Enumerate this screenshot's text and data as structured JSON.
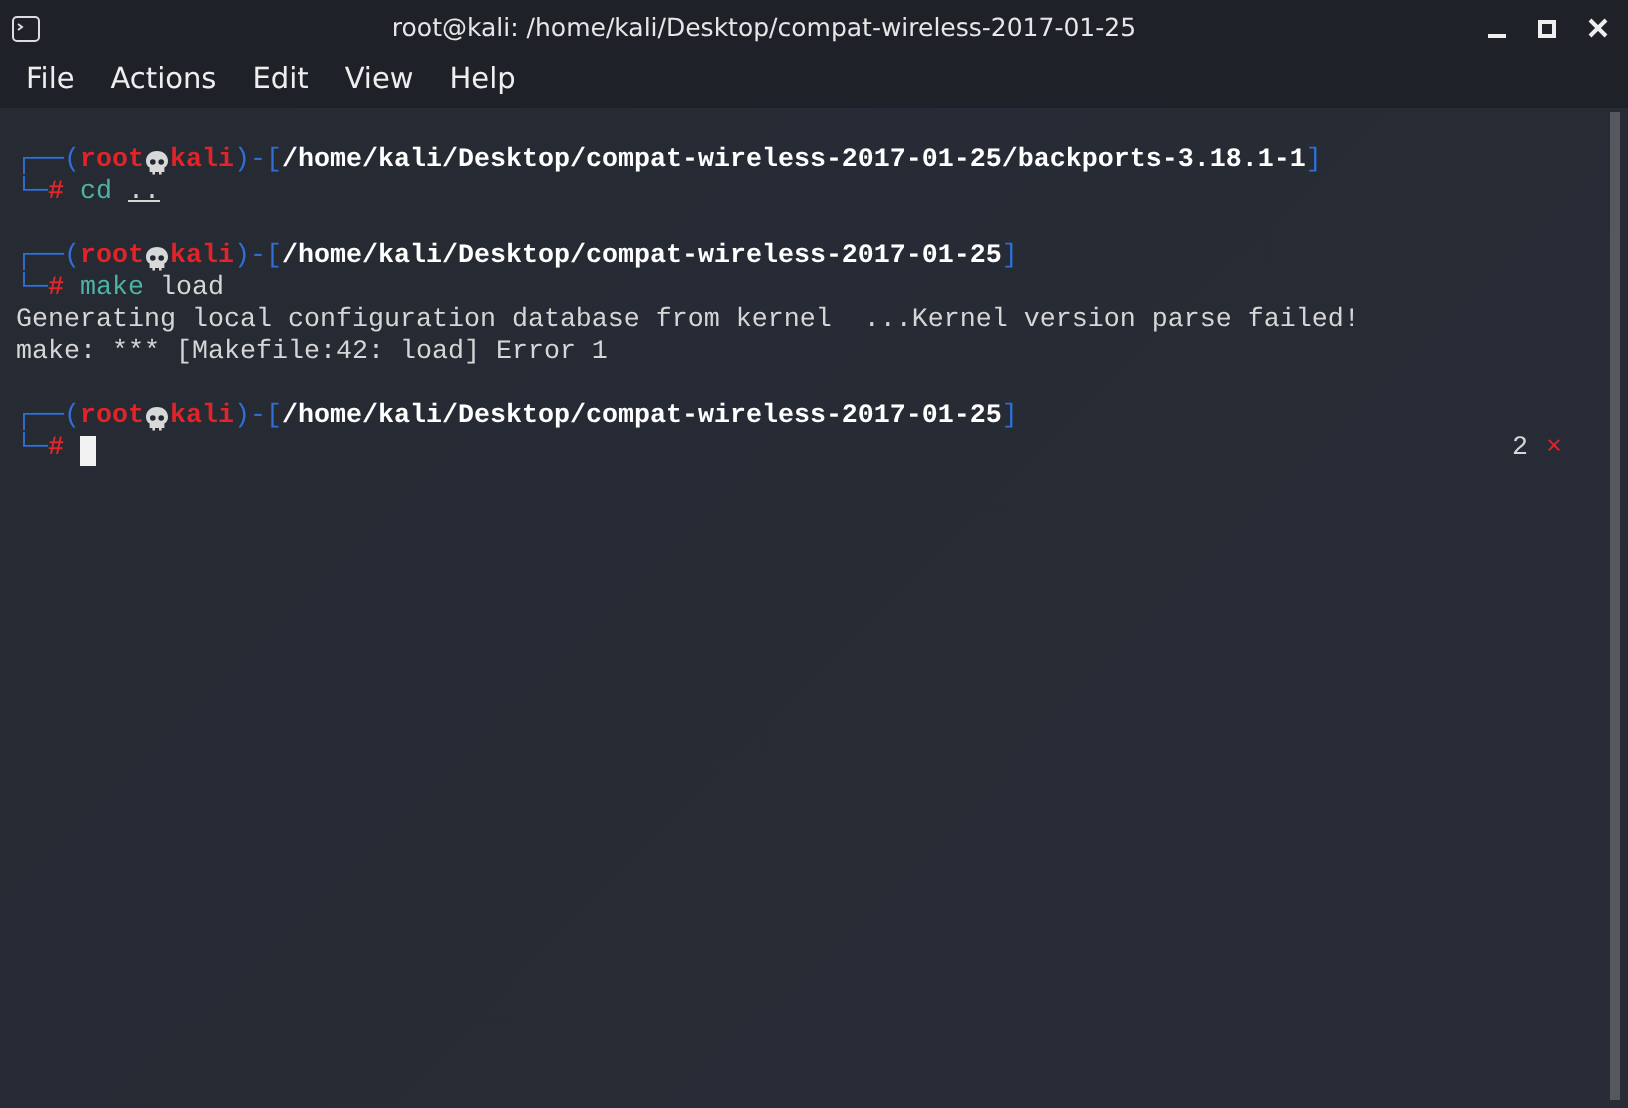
{
  "window": {
    "title": "root@kali: /home/kali/Desktop/compat-wireless-2017-01-25"
  },
  "menu": [
    "File",
    "Actions",
    "Edit",
    "View",
    "Help"
  ],
  "lines": [
    {
      "kind": "prompt",
      "frame_open": "┌──(",
      "user": "root",
      "host": "kali",
      "frame_mid": ")-[",
      "path": "/home/kali/Desktop/compat-wireless-2017-01-25/backports-3.18.1-1",
      "frame_close": "]",
      "frame_lower": "└─",
      "symbol": "#",
      "tokens": [
        {
          "text": "cd",
          "kind": "command"
        },
        {
          "text": "..",
          "kind": "path"
        }
      ],
      "cursor": false
    },
    {
      "kind": "blank"
    },
    {
      "kind": "prompt",
      "frame_open": "┌──(",
      "user": "root",
      "host": "kali",
      "frame_mid": ")-[",
      "path": "/home/kali/Desktop/compat-wireless-2017-01-25",
      "frame_close": "]",
      "frame_lower": "└─",
      "symbol": "#",
      "tokens": [
        {
          "text": "make",
          "kind": "command"
        },
        {
          "text": "load",
          "kind": "argument"
        }
      ],
      "cursor": false
    },
    {
      "kind": "output",
      "text": "Generating local configuration database from kernel  ...Kernel version parse failed!"
    },
    {
      "kind": "output",
      "text": "make: *** [Makefile:42: load] Error 1"
    },
    {
      "kind": "blank"
    },
    {
      "kind": "prompt",
      "frame_open": "┌──(",
      "user": "root",
      "host": "kali",
      "frame_mid": ")-[",
      "path": "/home/kali/Desktop/compat-wireless-2017-01-25",
      "frame_close": "]",
      "frame_lower": "└─",
      "symbol": "#",
      "cursor": true,
      "exit_code": "2",
      "exit_mark": "×"
    }
  ]
}
